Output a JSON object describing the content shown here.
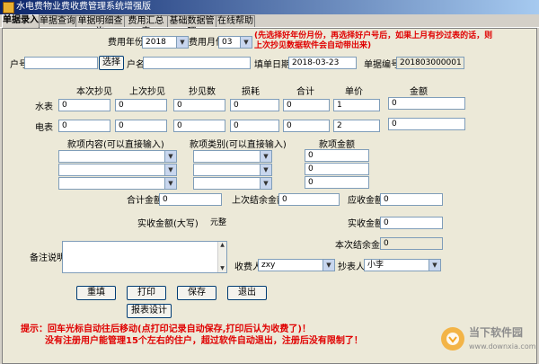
{
  "window": {
    "title": "水电费物业费收费管理系统增强版"
  },
  "tabs": [
    "单据录入",
    "单据查询",
    "单据明细查询",
    "费用汇总表",
    "基础数据管理",
    "在线帮助"
  ],
  "header": {
    "year_label": "费用年份",
    "year_value": "2018",
    "month_label": "费用月份",
    "month_value": "03",
    "tip": "(先选择好年份月份，再选择好户号后，如果上月有抄过表的话，则上次抄见数据软件会自动带出来)"
  },
  "account": {
    "account_no_label": "户号",
    "account_no_value": "",
    "select_button": "选择",
    "name_label": "户名",
    "name_value": "",
    "date_label": "填单日期",
    "date_value": "2018-03-23",
    "doc_no_label": "单据编号",
    "doc_no_value": "201803000001"
  },
  "meter_table": {
    "columns": [
      "本次抄见",
      "上次抄见",
      "抄见数",
      "损耗",
      "合计",
      "单价",
      "金额"
    ],
    "rows": [
      {
        "label": "水表",
        "values": [
          "0",
          "0",
          "0",
          "0",
          "0",
          "1",
          "0"
        ]
      },
      {
        "label": "电表",
        "values": [
          "0",
          "0",
          "0",
          "0",
          "0",
          "2",
          "0"
        ]
      }
    ]
  },
  "items": {
    "content_label": "款项内容(可以直接输入)",
    "category_label": "款项类别(可以直接输入)",
    "amount_label": "款项金额",
    "rows": [
      {
        "content": "",
        "category": "",
        "amount": "0"
      },
      {
        "content": "",
        "category": "",
        "amount": "0"
      },
      {
        "content": "",
        "category": "",
        "amount": "0"
      }
    ]
  },
  "totals": {
    "total_label": "合计金额",
    "total_value": "0",
    "prev_balance_label": "上次结余金额",
    "prev_balance_value": "0",
    "receivable_label": "应收金额",
    "receivable_value": "0",
    "paid_upper_label": "实收金额(大写)",
    "paid_upper_value": "元整",
    "paid_label": "实收金额",
    "paid_value": "0",
    "balance_label": "本次结余金额",
    "balance_value": "0"
  },
  "remarks": {
    "label": "备注说明",
    "value": ""
  },
  "people": {
    "collector_label": "收费人",
    "collector_value": "zxy",
    "reader_label": "抄表人",
    "reader_value": "小李"
  },
  "buttons": {
    "reenter": "重填",
    "print": "打印",
    "save": "保存",
    "exit": "退出",
    "design": "报表设计"
  },
  "hints": {
    "line1": "提示：回车光标自动往后移动(点打印记录自动保存,打印后认为收费了)！",
    "line2": "没有注册用户能管理15个左右的住户，超过软件自动退出，注册后没有限制了！"
  },
  "watermark": {
    "name": "当下软件园",
    "url": "www.downxia.com"
  },
  "colors": {
    "hint": "#e00000",
    "title_start": "#0a246a",
    "title_end": "#a6caf0"
  }
}
